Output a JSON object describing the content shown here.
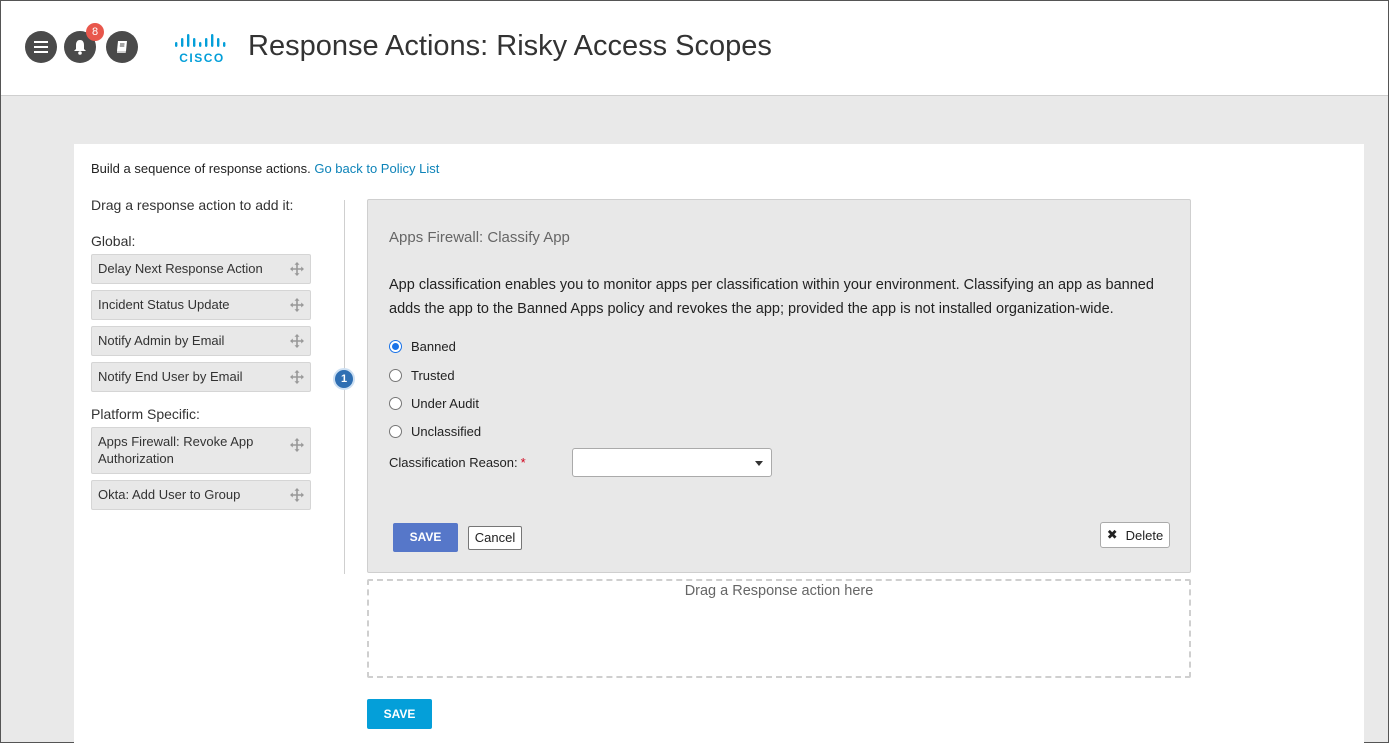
{
  "header": {
    "title": "Response Actions: Risky Access Scopes",
    "logo_text": "CISCO",
    "menu_icon": "hamburger-menu-icon",
    "notifications": {
      "icon": "bell-icon",
      "count": "8"
    },
    "docs_icon": "book-icon",
    "badge_color": "#e8574c",
    "logo_color": "#049fd9"
  },
  "intro": {
    "text": "Build a sequence of response actions.",
    "link": "Go back to Policy List"
  },
  "palette": {
    "drag_hint": "Drag a response action to add it:",
    "global_title": "Global:",
    "global_items": [
      "Delay Next Response Action",
      "Incident Status Update",
      "Notify Admin by Email",
      "Notify End User by Email"
    ],
    "platform_title": "Platform Specific:",
    "platform_items": [
      "Apps Firewall: Revoke App Authorization",
      "Okta: Add User to Group"
    ]
  },
  "step": {
    "number": "1"
  },
  "card": {
    "title": "Apps Firewall: Classify App",
    "description": "App classification enables you to monitor apps per classification within your environment. Classifying an app as banned adds the app to the Banned Apps policy and revokes the app; provided the app is not installed organization-wide.",
    "options": [
      "Banned",
      "Trusted",
      "Under Audit",
      "Unclassified"
    ],
    "selected": "Banned",
    "reason_label": "Classification Reason:",
    "required_mark": "*",
    "reason_value": "",
    "save_label": "SAVE",
    "cancel_label": "Cancel",
    "delete_label": "Delete"
  },
  "dropzone": {
    "text": "Drag a Response action here"
  },
  "footer": {
    "save_label": "SAVE"
  }
}
